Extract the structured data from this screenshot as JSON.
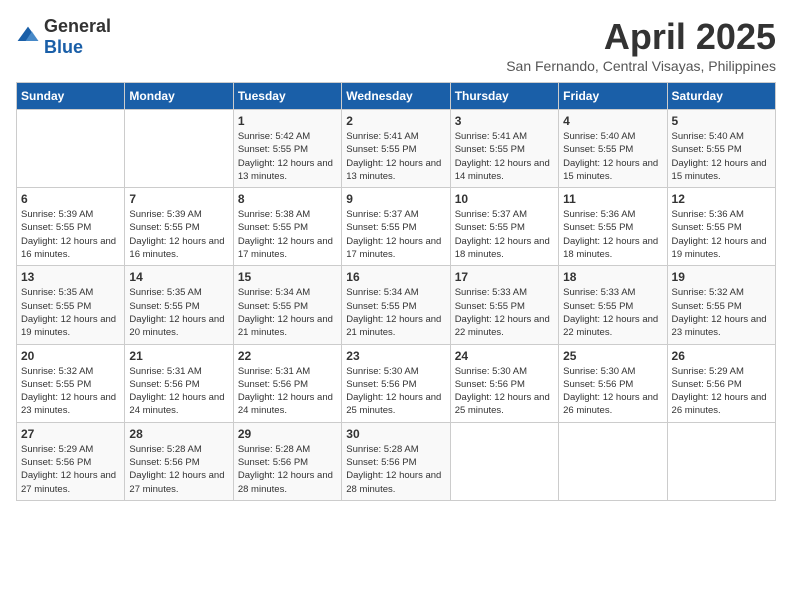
{
  "header": {
    "logo_general": "General",
    "logo_blue": "Blue",
    "month": "April 2025",
    "location": "San Fernando, Central Visayas, Philippines"
  },
  "weekdays": [
    "Sunday",
    "Monday",
    "Tuesday",
    "Wednesday",
    "Thursday",
    "Friday",
    "Saturday"
  ],
  "weeks": [
    [
      {
        "day": "",
        "sunrise": "",
        "sunset": "",
        "daylight": ""
      },
      {
        "day": "",
        "sunrise": "",
        "sunset": "",
        "daylight": ""
      },
      {
        "day": "1",
        "sunrise": "Sunrise: 5:42 AM",
        "sunset": "Sunset: 5:55 PM",
        "daylight": "Daylight: 12 hours and 13 minutes."
      },
      {
        "day": "2",
        "sunrise": "Sunrise: 5:41 AM",
        "sunset": "Sunset: 5:55 PM",
        "daylight": "Daylight: 12 hours and 13 minutes."
      },
      {
        "day": "3",
        "sunrise": "Sunrise: 5:41 AM",
        "sunset": "Sunset: 5:55 PM",
        "daylight": "Daylight: 12 hours and 14 minutes."
      },
      {
        "day": "4",
        "sunrise": "Sunrise: 5:40 AM",
        "sunset": "Sunset: 5:55 PM",
        "daylight": "Daylight: 12 hours and 15 minutes."
      },
      {
        "day": "5",
        "sunrise": "Sunrise: 5:40 AM",
        "sunset": "Sunset: 5:55 PM",
        "daylight": "Daylight: 12 hours and 15 minutes."
      }
    ],
    [
      {
        "day": "6",
        "sunrise": "Sunrise: 5:39 AM",
        "sunset": "Sunset: 5:55 PM",
        "daylight": "Daylight: 12 hours and 16 minutes."
      },
      {
        "day": "7",
        "sunrise": "Sunrise: 5:39 AM",
        "sunset": "Sunset: 5:55 PM",
        "daylight": "Daylight: 12 hours and 16 minutes."
      },
      {
        "day": "8",
        "sunrise": "Sunrise: 5:38 AM",
        "sunset": "Sunset: 5:55 PM",
        "daylight": "Daylight: 12 hours and 17 minutes."
      },
      {
        "day": "9",
        "sunrise": "Sunrise: 5:37 AM",
        "sunset": "Sunset: 5:55 PM",
        "daylight": "Daylight: 12 hours and 17 minutes."
      },
      {
        "day": "10",
        "sunrise": "Sunrise: 5:37 AM",
        "sunset": "Sunset: 5:55 PM",
        "daylight": "Daylight: 12 hours and 18 minutes."
      },
      {
        "day": "11",
        "sunrise": "Sunrise: 5:36 AM",
        "sunset": "Sunset: 5:55 PM",
        "daylight": "Daylight: 12 hours and 18 minutes."
      },
      {
        "day": "12",
        "sunrise": "Sunrise: 5:36 AM",
        "sunset": "Sunset: 5:55 PM",
        "daylight": "Daylight: 12 hours and 19 minutes."
      }
    ],
    [
      {
        "day": "13",
        "sunrise": "Sunrise: 5:35 AM",
        "sunset": "Sunset: 5:55 PM",
        "daylight": "Daylight: 12 hours and 19 minutes."
      },
      {
        "day": "14",
        "sunrise": "Sunrise: 5:35 AM",
        "sunset": "Sunset: 5:55 PM",
        "daylight": "Daylight: 12 hours and 20 minutes."
      },
      {
        "day": "15",
        "sunrise": "Sunrise: 5:34 AM",
        "sunset": "Sunset: 5:55 PM",
        "daylight": "Daylight: 12 hours and 21 minutes."
      },
      {
        "day": "16",
        "sunrise": "Sunrise: 5:34 AM",
        "sunset": "Sunset: 5:55 PM",
        "daylight": "Daylight: 12 hours and 21 minutes."
      },
      {
        "day": "17",
        "sunrise": "Sunrise: 5:33 AM",
        "sunset": "Sunset: 5:55 PM",
        "daylight": "Daylight: 12 hours and 22 minutes."
      },
      {
        "day": "18",
        "sunrise": "Sunrise: 5:33 AM",
        "sunset": "Sunset: 5:55 PM",
        "daylight": "Daylight: 12 hours and 22 minutes."
      },
      {
        "day": "19",
        "sunrise": "Sunrise: 5:32 AM",
        "sunset": "Sunset: 5:55 PM",
        "daylight": "Daylight: 12 hours and 23 minutes."
      }
    ],
    [
      {
        "day": "20",
        "sunrise": "Sunrise: 5:32 AM",
        "sunset": "Sunset: 5:55 PM",
        "daylight": "Daylight: 12 hours and 23 minutes."
      },
      {
        "day": "21",
        "sunrise": "Sunrise: 5:31 AM",
        "sunset": "Sunset: 5:56 PM",
        "daylight": "Daylight: 12 hours and 24 minutes."
      },
      {
        "day": "22",
        "sunrise": "Sunrise: 5:31 AM",
        "sunset": "Sunset: 5:56 PM",
        "daylight": "Daylight: 12 hours and 24 minutes."
      },
      {
        "day": "23",
        "sunrise": "Sunrise: 5:30 AM",
        "sunset": "Sunset: 5:56 PM",
        "daylight": "Daylight: 12 hours and 25 minutes."
      },
      {
        "day": "24",
        "sunrise": "Sunrise: 5:30 AM",
        "sunset": "Sunset: 5:56 PM",
        "daylight": "Daylight: 12 hours and 25 minutes."
      },
      {
        "day": "25",
        "sunrise": "Sunrise: 5:30 AM",
        "sunset": "Sunset: 5:56 PM",
        "daylight": "Daylight: 12 hours and 26 minutes."
      },
      {
        "day": "26",
        "sunrise": "Sunrise: 5:29 AM",
        "sunset": "Sunset: 5:56 PM",
        "daylight": "Daylight: 12 hours and 26 minutes."
      }
    ],
    [
      {
        "day": "27",
        "sunrise": "Sunrise: 5:29 AM",
        "sunset": "Sunset: 5:56 PM",
        "daylight": "Daylight: 12 hours and 27 minutes."
      },
      {
        "day": "28",
        "sunrise": "Sunrise: 5:28 AM",
        "sunset": "Sunset: 5:56 PM",
        "daylight": "Daylight: 12 hours and 27 minutes."
      },
      {
        "day": "29",
        "sunrise": "Sunrise: 5:28 AM",
        "sunset": "Sunset: 5:56 PM",
        "daylight": "Daylight: 12 hours and 28 minutes."
      },
      {
        "day": "30",
        "sunrise": "Sunrise: 5:28 AM",
        "sunset": "Sunset: 5:56 PM",
        "daylight": "Daylight: 12 hours and 28 minutes."
      },
      {
        "day": "",
        "sunrise": "",
        "sunset": "",
        "daylight": ""
      },
      {
        "day": "",
        "sunrise": "",
        "sunset": "",
        "daylight": ""
      },
      {
        "day": "",
        "sunrise": "",
        "sunset": "",
        "daylight": ""
      }
    ]
  ]
}
